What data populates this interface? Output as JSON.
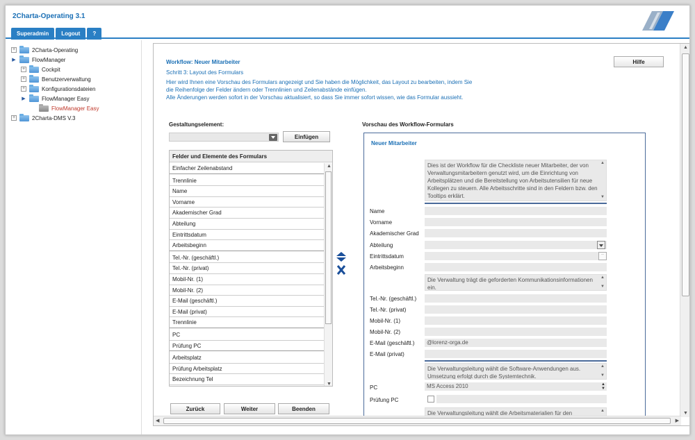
{
  "app": {
    "title": "2Charta-Operating 3.1"
  },
  "topnav": [
    "Superadmin",
    "Logout",
    "?"
  ],
  "tree": [
    {
      "label": "2Charta-Operating"
    },
    {
      "label": "FlowManager"
    },
    {
      "label": "Cockpit"
    },
    {
      "label": "Benutzerverwaltung"
    },
    {
      "label": "Konfigurationsdateien"
    },
    {
      "label": "FlowManager Easy"
    },
    {
      "label": "FlowManager Easy"
    },
    {
      "label": "2Charta-DMS V.3"
    }
  ],
  "header": {
    "title": "Workflow: Neuer Mitarbeiter",
    "step": "Schritt 3: Layout des Formulars",
    "desc": [
      "Hier wird Ihnen eine Vorschau des Formulars angezeigt und Sie haben die Möglichkeit, das Layout zu bearbeiten, indem Sie",
      "die Reihenfolge der Felder ändern oder Trennlinien und Zeilenabstände einfügen.",
      "Alle Änderungen werden sofort in der Vorschau aktualisiert, so dass Sie immer sofort wissen, wie das Formular aussieht."
    ],
    "help": "Hilfe"
  },
  "designer": {
    "element_label": "Gestaltungselement:",
    "insert_button": "Einfügen",
    "fields_header": "Felder und Elemente des Formulars",
    "fields": [
      "Einfacher Zeilenabstand",
      "Trennlinie",
      "Name",
      "Vorname",
      "Akademischer Grad",
      "Abteilung",
      "Eintrittsdatum",
      "Arbeitsbeginn",
      "Tel.-Nr. (geschäftl.)",
      "Tel.-Nr. (privat)",
      "Mobil-Nr. (1)",
      "Mobil-Nr. (2)",
      "E-Mail (geschäftl.)",
      "E-Mail (privat)",
      "Trennlinie",
      "PC",
      "Prüfung PC",
      "Arbeitsplatz",
      "Prüfung Arbeitsplatz",
      "Bezeichnung Tel"
    ]
  },
  "nav_buttons": {
    "back": "Zurück",
    "next": "Weiter",
    "finish": "Beenden"
  },
  "preview": {
    "header": "Vorschau des Workflow-Formulars",
    "form_title": "Neuer Mitarbeiter",
    "intro_text": "Dies ist der Workflow für die Checkliste neuer Mitarbeiter, der von Verwaltungsmitarbeitern genutzt wird, um die Einrichtung von Arbeitsplätzen und die Bereitstellung von Arbeitsutensilien für neue Kollegen zu steuern. Alle Arbeitsschritte sind in den Feldern bzw. den Tooltips erklärt.",
    "labels": {
      "name": "Name",
      "vorname": "Vorname",
      "grad": "Akademischer Grad",
      "abteilung": "Abteilung",
      "eintritt": "Eintrittsdatum",
      "beginn": "Arbeitsbeginn",
      "tel_g": "Tel.-Nr. (geschäftl.)",
      "tel_p": "Tel.-Nr. (privat)",
      "mobil1": "Mobil-Nr. (1)",
      "mobil2": "Mobil-Nr. (2)",
      "mail_g": "E-Mail (geschäftl.)",
      "mail_p": "E-Mail (privat)",
      "pc": "PC",
      "pruef_pc": "Prüfung PC"
    },
    "comm_text": "Die Verwaltung trägt die geforderten Kommunikationsinformationen ein.",
    "mail_value": "@lorenz-orga.de",
    "sw_text": "Die Verwaltungsleitung wählt die Software-Anwendungen aus. Umsetzung erfolgt durch die Systemtechnik.",
    "pc_value": "MS Access 2010",
    "material_text": "Die Verwaltungsleitung wählt die Arbeitsmaterialien für den"
  }
}
